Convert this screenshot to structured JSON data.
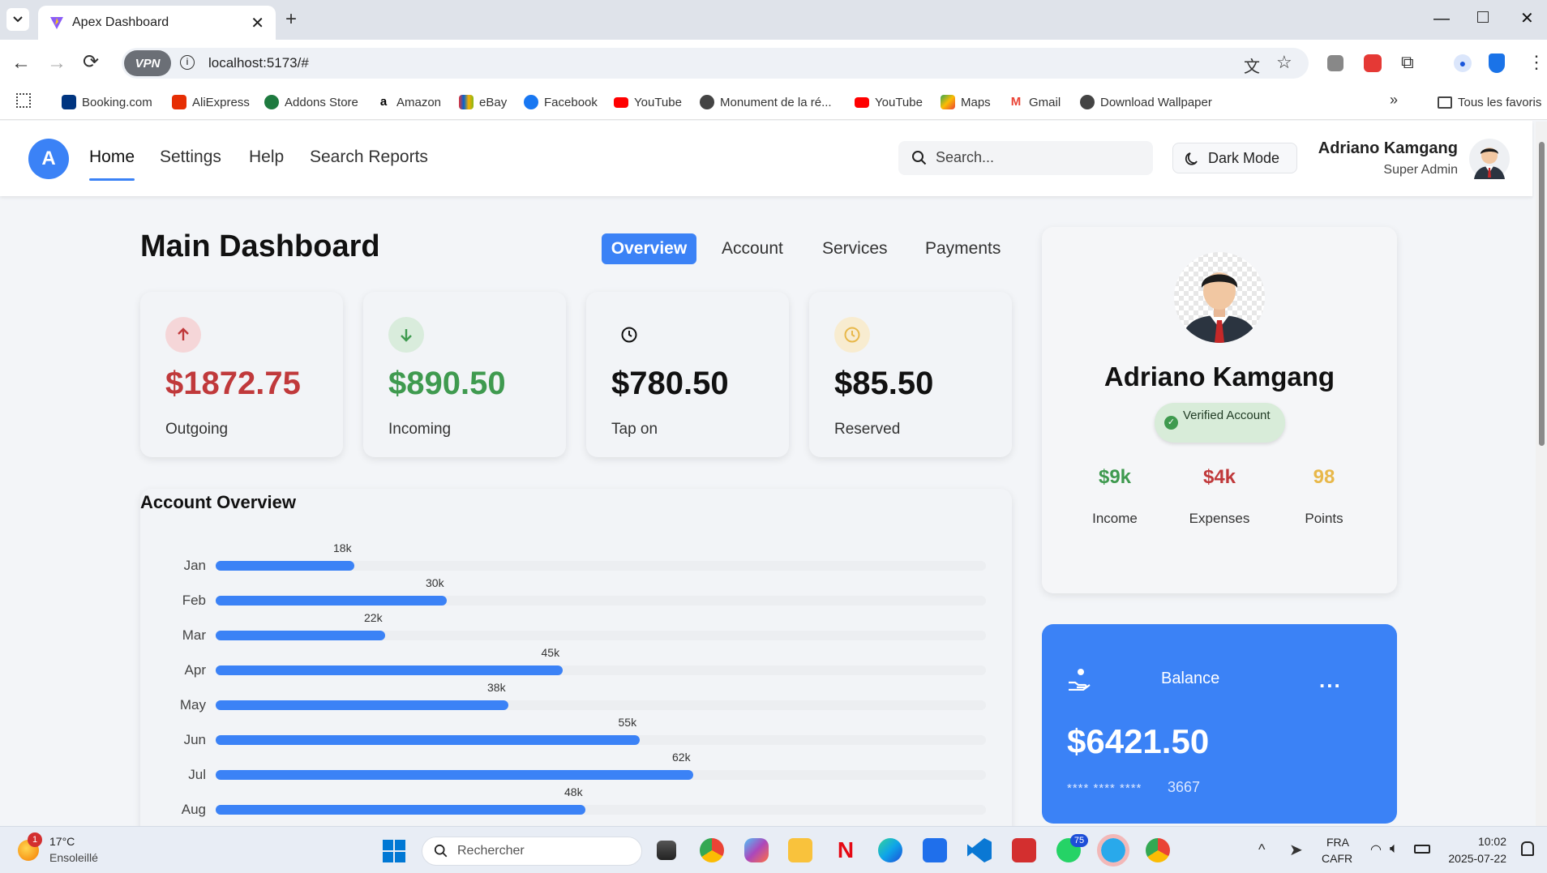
{
  "browser": {
    "tab_title": "Apex Dashboard",
    "url": "localhost:5173/#",
    "vpn_label": "VPN",
    "bookmarks": [
      "Booking.com",
      "AliExpress",
      "Addons Store",
      "Amazon",
      "eBay",
      "Facebook",
      "YouTube",
      "Monument de la ré...",
      "YouTube",
      "Maps",
      "Gmail",
      "Download Wallpaper"
    ],
    "all_bookmarks": "Tous les favoris"
  },
  "app": {
    "logo_letter": "A",
    "nav": [
      "Home",
      "Settings",
      "Help",
      "Search Reports"
    ],
    "search_placeholder": "Search...",
    "dark_mode": "Dark Mode",
    "user_name": "Adriano Kamgang",
    "user_role": "Super Admin"
  },
  "main": {
    "title": "Main Dashboard",
    "tabs": [
      "Overview",
      "Account",
      "Services",
      "Payments"
    ],
    "stats": [
      {
        "amount": "$1872.75",
        "label": "Outgoing",
        "color": "#c0393b"
      },
      {
        "amount": "$890.50",
        "label": "Incoming",
        "color": "#3f9a4f"
      },
      {
        "amount": "$780.50",
        "label": "Tap on",
        "color": "#111111"
      },
      {
        "amount": "$85.50",
        "label": "Reserved",
        "color": "#111111"
      }
    ],
    "overview_title": "Account Overview"
  },
  "chart_data": {
    "type": "bar",
    "orientation": "horizontal",
    "categories": [
      "Jan",
      "Feb",
      "Mar",
      "Apr",
      "May",
      "Jun",
      "Jul",
      "Aug"
    ],
    "values": [
      18,
      30,
      22,
      45,
      38,
      55,
      62,
      48
    ],
    "value_labels": [
      "18k",
      "30k",
      "22k",
      "45k",
      "38k",
      "55k",
      "62k",
      "48k"
    ],
    "xlim": [
      0,
      100
    ],
    "color": "#3b82f6",
    "grid": false
  },
  "profile": {
    "name": "Adriano Kamgang",
    "verified": "Verified Account",
    "metrics": [
      {
        "value": "$9k",
        "label": "Income",
        "color": "#3f9a4f"
      },
      {
        "value": "$4k",
        "label": "Expenses",
        "color": "#c0393b"
      },
      {
        "value": "98",
        "label": "Points",
        "color": "#e8b84a"
      }
    ]
  },
  "balance": {
    "title": "Balance",
    "amount": "$6421.50",
    "card_mask": "**** **** ****",
    "card_last": "3667",
    "menu": "..."
  },
  "taskbar": {
    "weather_temp": "17°C",
    "weather_desc": "Ensoleillé",
    "weather_badge": "1",
    "search_placeholder": "Rechercher",
    "whatsapp_badge": "75",
    "lang_top": "FRA",
    "lang_bottom": "CAFR",
    "time": "10:02",
    "date": "2025-07-22"
  }
}
